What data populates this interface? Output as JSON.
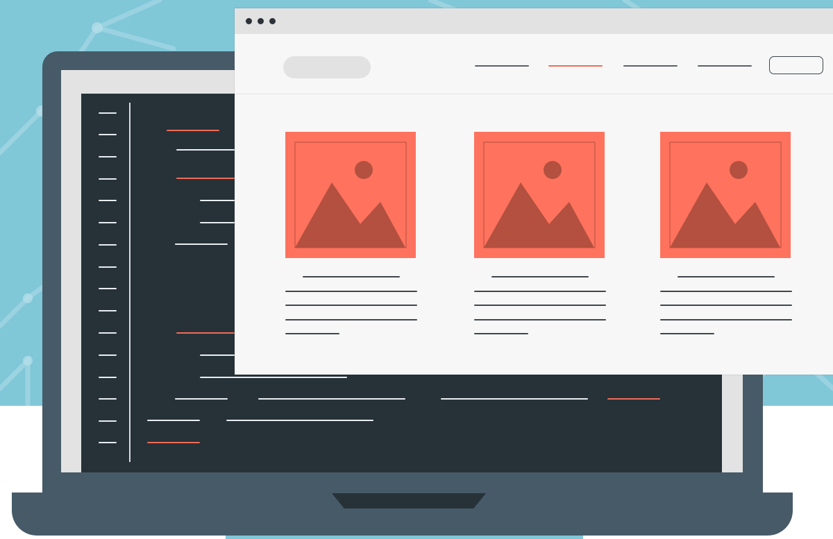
{
  "colors": {
    "background_blue": "#80c7d8",
    "laptop_body": "#465a68",
    "bezel": "#e3e3e3",
    "code_background": "#263238",
    "accent": "#f26b57",
    "browser_background": "#f7f7f7",
    "image_placeholder": "#ff725e",
    "image_shape": "#b3503f"
  },
  "browser": {
    "window_control_icons": [
      "dot-icon",
      "dot-icon",
      "dot-icon"
    ],
    "logo_placeholder": "logo-pill",
    "nav_links": [
      {
        "name": "nav-link-1",
        "active": false
      },
      {
        "name": "nav-link-2",
        "active": true
      },
      {
        "name": "nav-link-3",
        "active": false
      },
      {
        "name": "nav-link-4",
        "active": false
      }
    ],
    "header_button": "outline-button",
    "cards": [
      {
        "name": "card-1",
        "image_icon": "image-placeholder-icon",
        "text_lines": 5
      },
      {
        "name": "card-2",
        "image_icon": "image-placeholder-icon",
        "text_lines": 5
      },
      {
        "name": "card-3",
        "image_icon": "image-placeholder-icon",
        "text_lines": 5
      }
    ]
  },
  "laptop": {
    "editor_line_count": 16,
    "icon": "laptop-icon"
  }
}
